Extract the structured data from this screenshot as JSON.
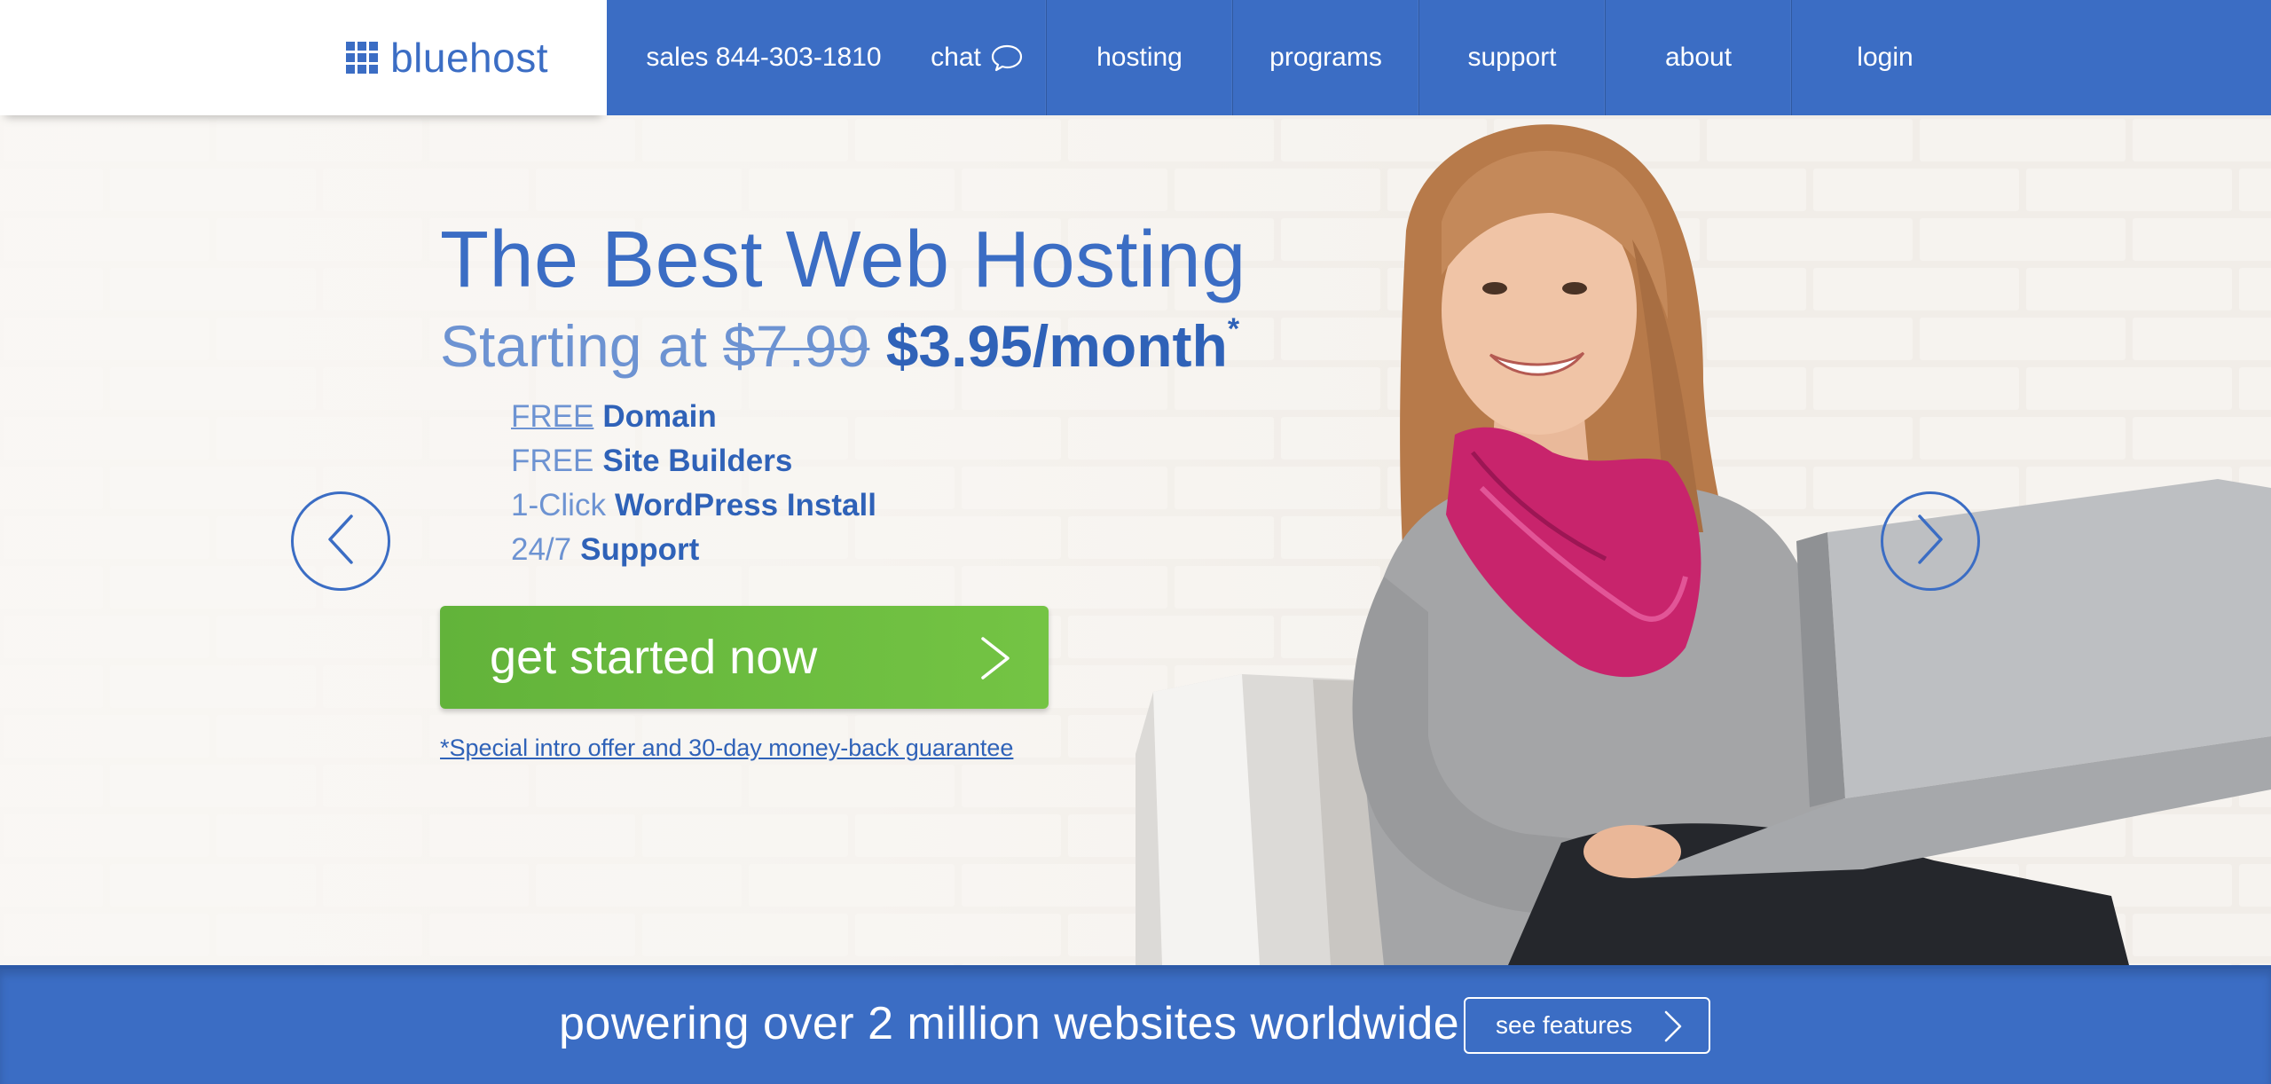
{
  "header": {
    "logo_text": "bluehost",
    "nav": {
      "sales": "sales 844-303-1810",
      "chat": "chat",
      "hosting": "hosting",
      "programs": "programs",
      "support": "support",
      "about": "about",
      "login": "login"
    }
  },
  "hero": {
    "title": "The Best Web Hosting",
    "subtitle_prefix": "Starting at",
    "old_price": "$7.99",
    "new_price": "$3.95/month",
    "asterisk": "*",
    "features": [
      {
        "light": "FREE",
        "bold": "Domain"
      },
      {
        "light": "FREE",
        "bold": "Site Builders"
      },
      {
        "light": "1-Click",
        "bold": "WordPress Install"
      },
      {
        "light": "24/7",
        "bold": "Support"
      }
    ],
    "cta_label": "get started now",
    "disclaimer": "*Special intro offer and 30-day money-back guarantee"
  },
  "banner": {
    "text": "powering over 2 million websites worldwide",
    "button_label": "see features"
  },
  "colors": {
    "brand_blue": "#3b6dc4",
    "light_blue": "#6d93d2",
    "cta_green": "#6abb3f",
    "scarf_pink": "#c8246c",
    "wall": "#efebe6"
  },
  "icons": {
    "logo": "grid-logo-icon",
    "chat": "speech-bubble-icon",
    "prev": "chevron-left-icon",
    "next": "chevron-right-icon",
    "cta": "chevron-right-icon",
    "features": "chevron-right-icon"
  }
}
